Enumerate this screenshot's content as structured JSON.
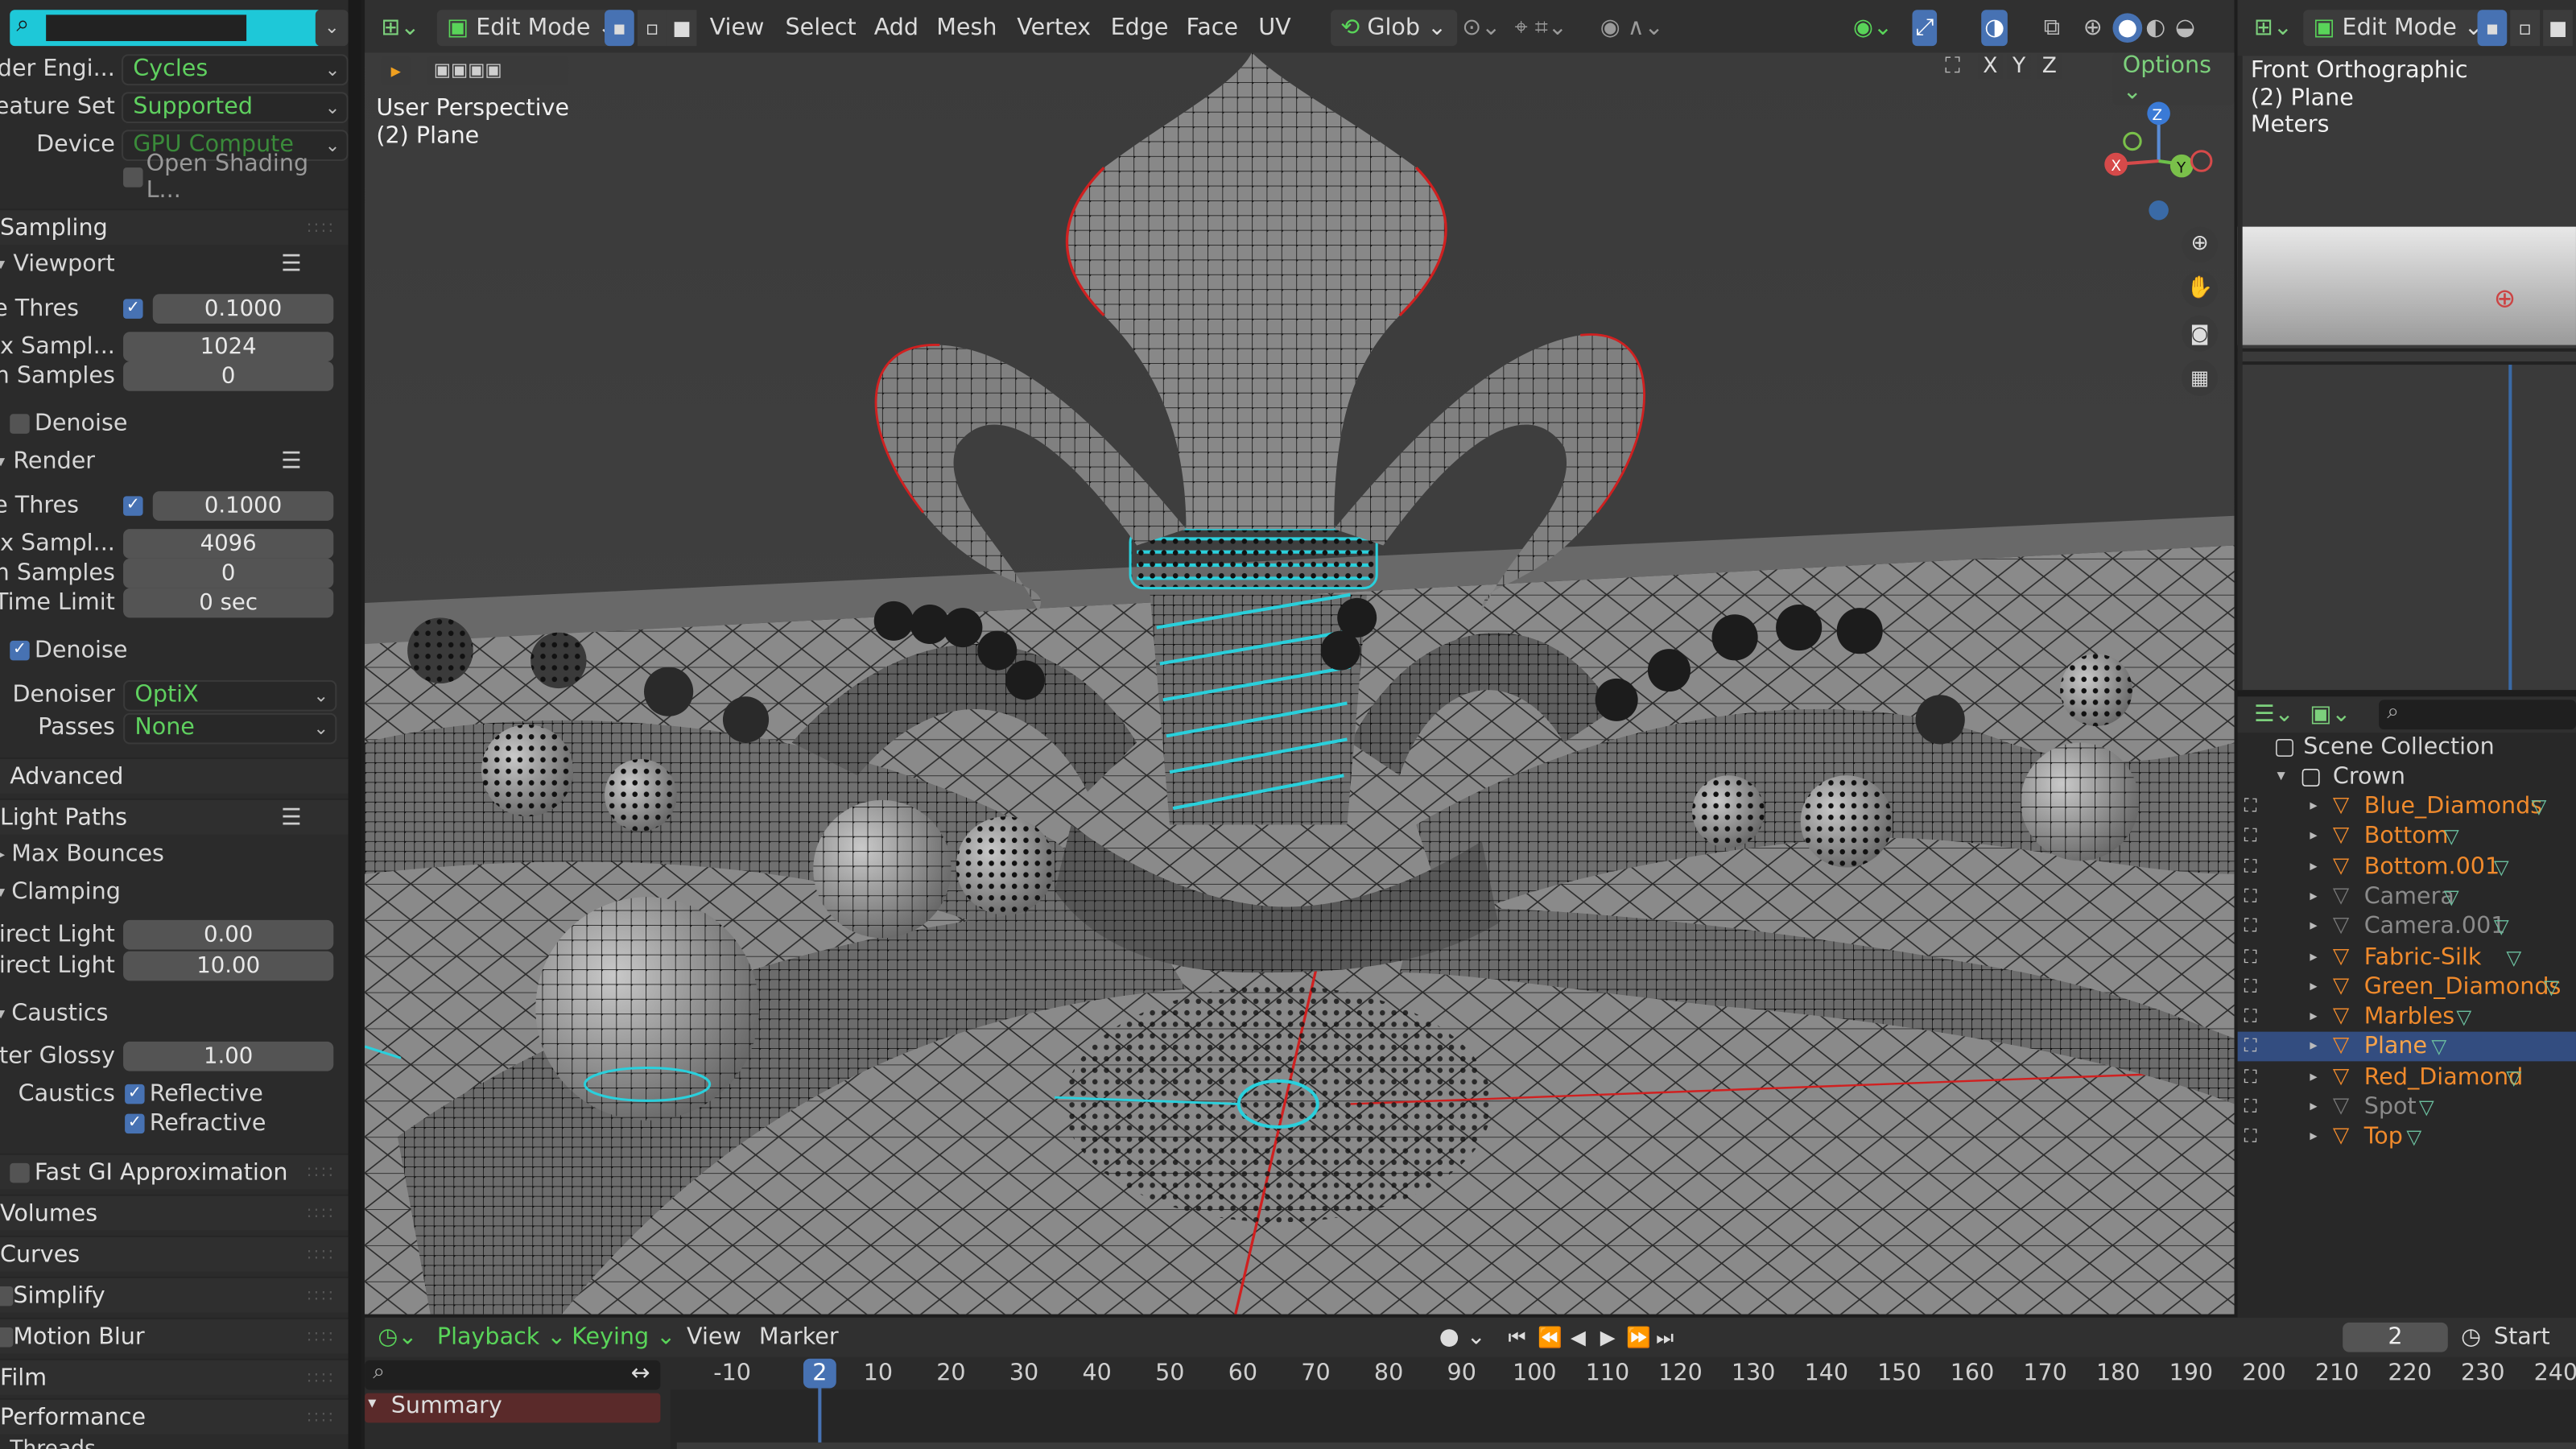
{
  "properties": {
    "render_engine": {
      "label": "nder Engi...",
      "value": "Cycles"
    },
    "feature_set": {
      "label": "eature Set",
      "value": "Supported"
    },
    "device": {
      "label": "Device",
      "value": "GPU Compute"
    },
    "open_shading": "Open Shading L...",
    "sampling": "Sampling",
    "viewport_hdr": "Viewport",
    "vp_noise_label": "ise Thres",
    "vp_noise_value": "0.1000",
    "vp_max_label": "ax Sampl...",
    "vp_max_value": "1024",
    "vp_min_label": "n Samples",
    "vp_min_value": "0",
    "vp_denoise": "Denoise",
    "render_hdr": "Render",
    "r_noise_label": "ise Thres",
    "r_noise_value": "0.1000",
    "r_max_label": "ax Sampl...",
    "r_max_value": "4096",
    "r_min_label": "n Samples",
    "r_min_value": "0",
    "r_time_label": "Time Limit",
    "r_time_value": "0 sec",
    "r_denoise": "Denoise",
    "denoiser": {
      "label": "Denoiser",
      "value": "OptiX"
    },
    "passes": {
      "label": "Passes",
      "value": "None"
    },
    "advanced": "Advanced",
    "light_paths": "Light Paths",
    "max_bounces": "Max Bounces",
    "clamping": "Clamping",
    "direct_label": "Direct Light",
    "direct_value": "0.00",
    "indirect_label": "direct Light",
    "indirect_value": "10.00",
    "caustics": "Caustics",
    "filter_label": "lter Glossy",
    "filter_value": "1.00",
    "caustics_label": "Caustics",
    "reflective": "Reflective",
    "refractive": "Refractive",
    "fast_gi": "Fast GI Approximation",
    "volumes": "Volumes",
    "curves": "Curves",
    "simplify": "Simplify",
    "motion_blur": "Motion Blur",
    "film": "Film",
    "performance": "Performance",
    "threads": "Threads"
  },
  "viewport_header": {
    "mode": "Edit Mode",
    "menus": [
      "View",
      "Select",
      "Add",
      "Mesh",
      "Vertex",
      "Edge",
      "Face",
      "UV"
    ],
    "orientation": "Glob",
    "options": "Options",
    "axes": [
      "X",
      "Y",
      "Z"
    ]
  },
  "viewport": {
    "line1": "User Perspective",
    "line2": "(2) Plane",
    "gizmo": [
      "Z",
      "X",
      "Y"
    ]
  },
  "right_viewport": {
    "mode": "Edit Mode",
    "line1": "Front Orthographic",
    "line2": "(2) Plane",
    "line3": "Meters"
  },
  "outliner": {
    "scene": "Scene Collection",
    "collection": "Crown",
    "items": [
      {
        "name": "Blue_Diamonds",
        "color": "#f08a2c"
      },
      {
        "name": "Bottom",
        "color": "#f08a2c"
      },
      {
        "name": "Bottom.001",
        "color": "#f08a2c"
      },
      {
        "name": "Camera",
        "color": "#8a8a8a"
      },
      {
        "name": "Camera.001",
        "color": "#8a8a8a"
      },
      {
        "name": "Fabric-Silk",
        "color": "#f08a2c"
      },
      {
        "name": "Green_Diamonds",
        "color": "#f08a2c"
      },
      {
        "name": "Marbles",
        "color": "#f08a2c"
      },
      {
        "name": "Plane",
        "color": "#f08a2c"
      },
      {
        "name": "Red_Diamond",
        "color": "#f08a2c"
      },
      {
        "name": "Spot",
        "color": "#8a8a8a"
      },
      {
        "name": "Top",
        "color": "#f08a2c"
      }
    ],
    "selected": "Plane"
  },
  "timeline": {
    "playback": "Playback",
    "keying": "Keying",
    "view": "View",
    "marker": "Marker",
    "current_frame": "2",
    "start_label": "Start",
    "summary": "Summary",
    "ticks": [
      "-10",
      "2",
      "10",
      "20",
      "30",
      "40",
      "50",
      "60",
      "70",
      "80",
      "90",
      "100",
      "110",
      "120",
      "130",
      "140",
      "150",
      "160",
      "170",
      "180",
      "190",
      "200",
      "210",
      "220",
      "230",
      "240"
    ]
  },
  "colors": {
    "accent_blue": "#4772b3",
    "cyan_search": "#1ec8d8",
    "green_text": "#5fd05f",
    "orange_object": "#f08a2c"
  }
}
